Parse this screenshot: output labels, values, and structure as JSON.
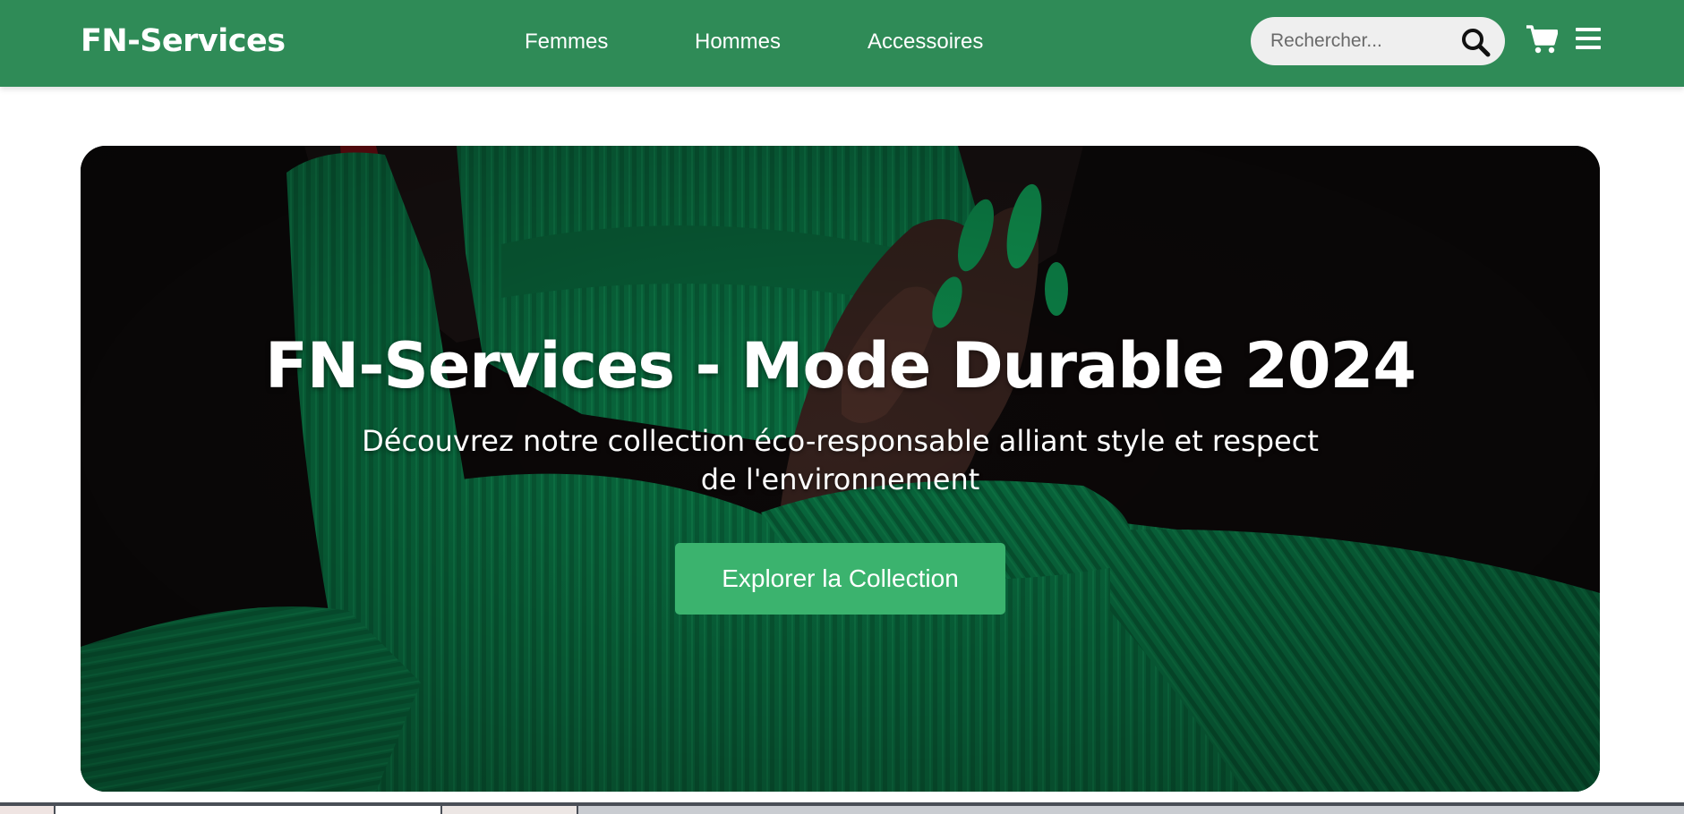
{
  "navbar": {
    "brand": "FN-Services",
    "links": [
      {
        "label": "Femmes"
      },
      {
        "label": "Hommes"
      },
      {
        "label": "Accessoires"
      }
    ],
    "search": {
      "placeholder": "Rechercher...",
      "value": ""
    },
    "icons": [
      "search-icon",
      "cart-icon",
      "menu-icon"
    ]
  },
  "hero": {
    "title": "FN-Services - Mode Durable 2024",
    "subtitle": "Découvrez notre collection éco-responsable alliant style et respect de l'environnement",
    "cta_label": "Explorer la Collection"
  },
  "colors": {
    "navbar": "#2f8b57",
    "cta": "#3bb36e",
    "sweater": "#0b7a48",
    "background": "#ffffff"
  }
}
